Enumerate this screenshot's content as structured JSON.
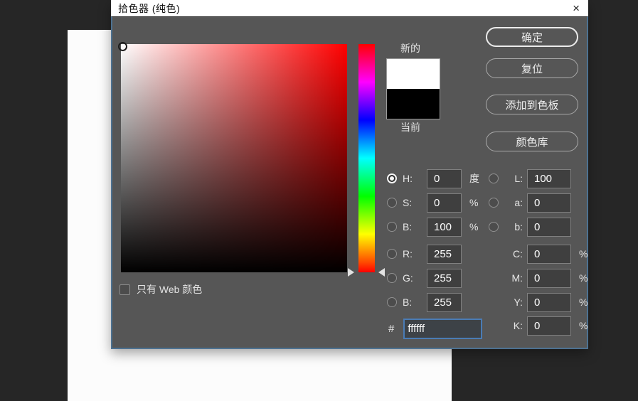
{
  "dialog": {
    "title": "拾色器 (纯色)",
    "close_glyph": "×",
    "buttons": {
      "ok": "确定",
      "reset": "复位",
      "add_to_swatches": "添加到色板",
      "color_libraries": "颜色库"
    },
    "swatch": {
      "new_label": "新的",
      "current_label": "当前",
      "new_color": "#ffffff",
      "current_color": "#000000"
    },
    "fields": {
      "hsb": [
        {
          "label": "H:",
          "value": "0",
          "unit": "度",
          "selected": true
        },
        {
          "label": "S:",
          "value": "0",
          "unit": "%",
          "selected": false
        },
        {
          "label": "B:",
          "value": "100",
          "unit": "%",
          "selected": false
        }
      ],
      "rgb": [
        {
          "label": "R:",
          "value": "255"
        },
        {
          "label": "G:",
          "value": "255"
        },
        {
          "label": "B:",
          "value": "255"
        }
      ],
      "lab": [
        {
          "label": "L:",
          "value": "100"
        },
        {
          "label": "a:",
          "value": "0"
        },
        {
          "label": "b:",
          "value": "0"
        }
      ],
      "cmyk": [
        {
          "label": "C:",
          "value": "0",
          "unit": "%"
        },
        {
          "label": "M:",
          "value": "0",
          "unit": "%"
        },
        {
          "label": "Y:",
          "value": "0",
          "unit": "%"
        },
        {
          "label": "K:",
          "value": "0",
          "unit": "%"
        }
      ],
      "hex": {
        "label": "#",
        "value": "ffffff"
      }
    },
    "web_only": {
      "label": "只有 Web 颜色",
      "checked": false
    },
    "hue_slider": {
      "selected_hue_deg": 0
    },
    "colors": {
      "dialog_bg": "#565656",
      "dialog_border": "#4d7191",
      "titlebar_bg": "#ffffff",
      "field_base_hue": "#ff0000",
      "input_bg": "#3f3f3f",
      "hex_focus_border": "#4a7cb5",
      "desktop_bg": "#262626",
      "canvas_bg": "#fcfcfc"
    }
  }
}
